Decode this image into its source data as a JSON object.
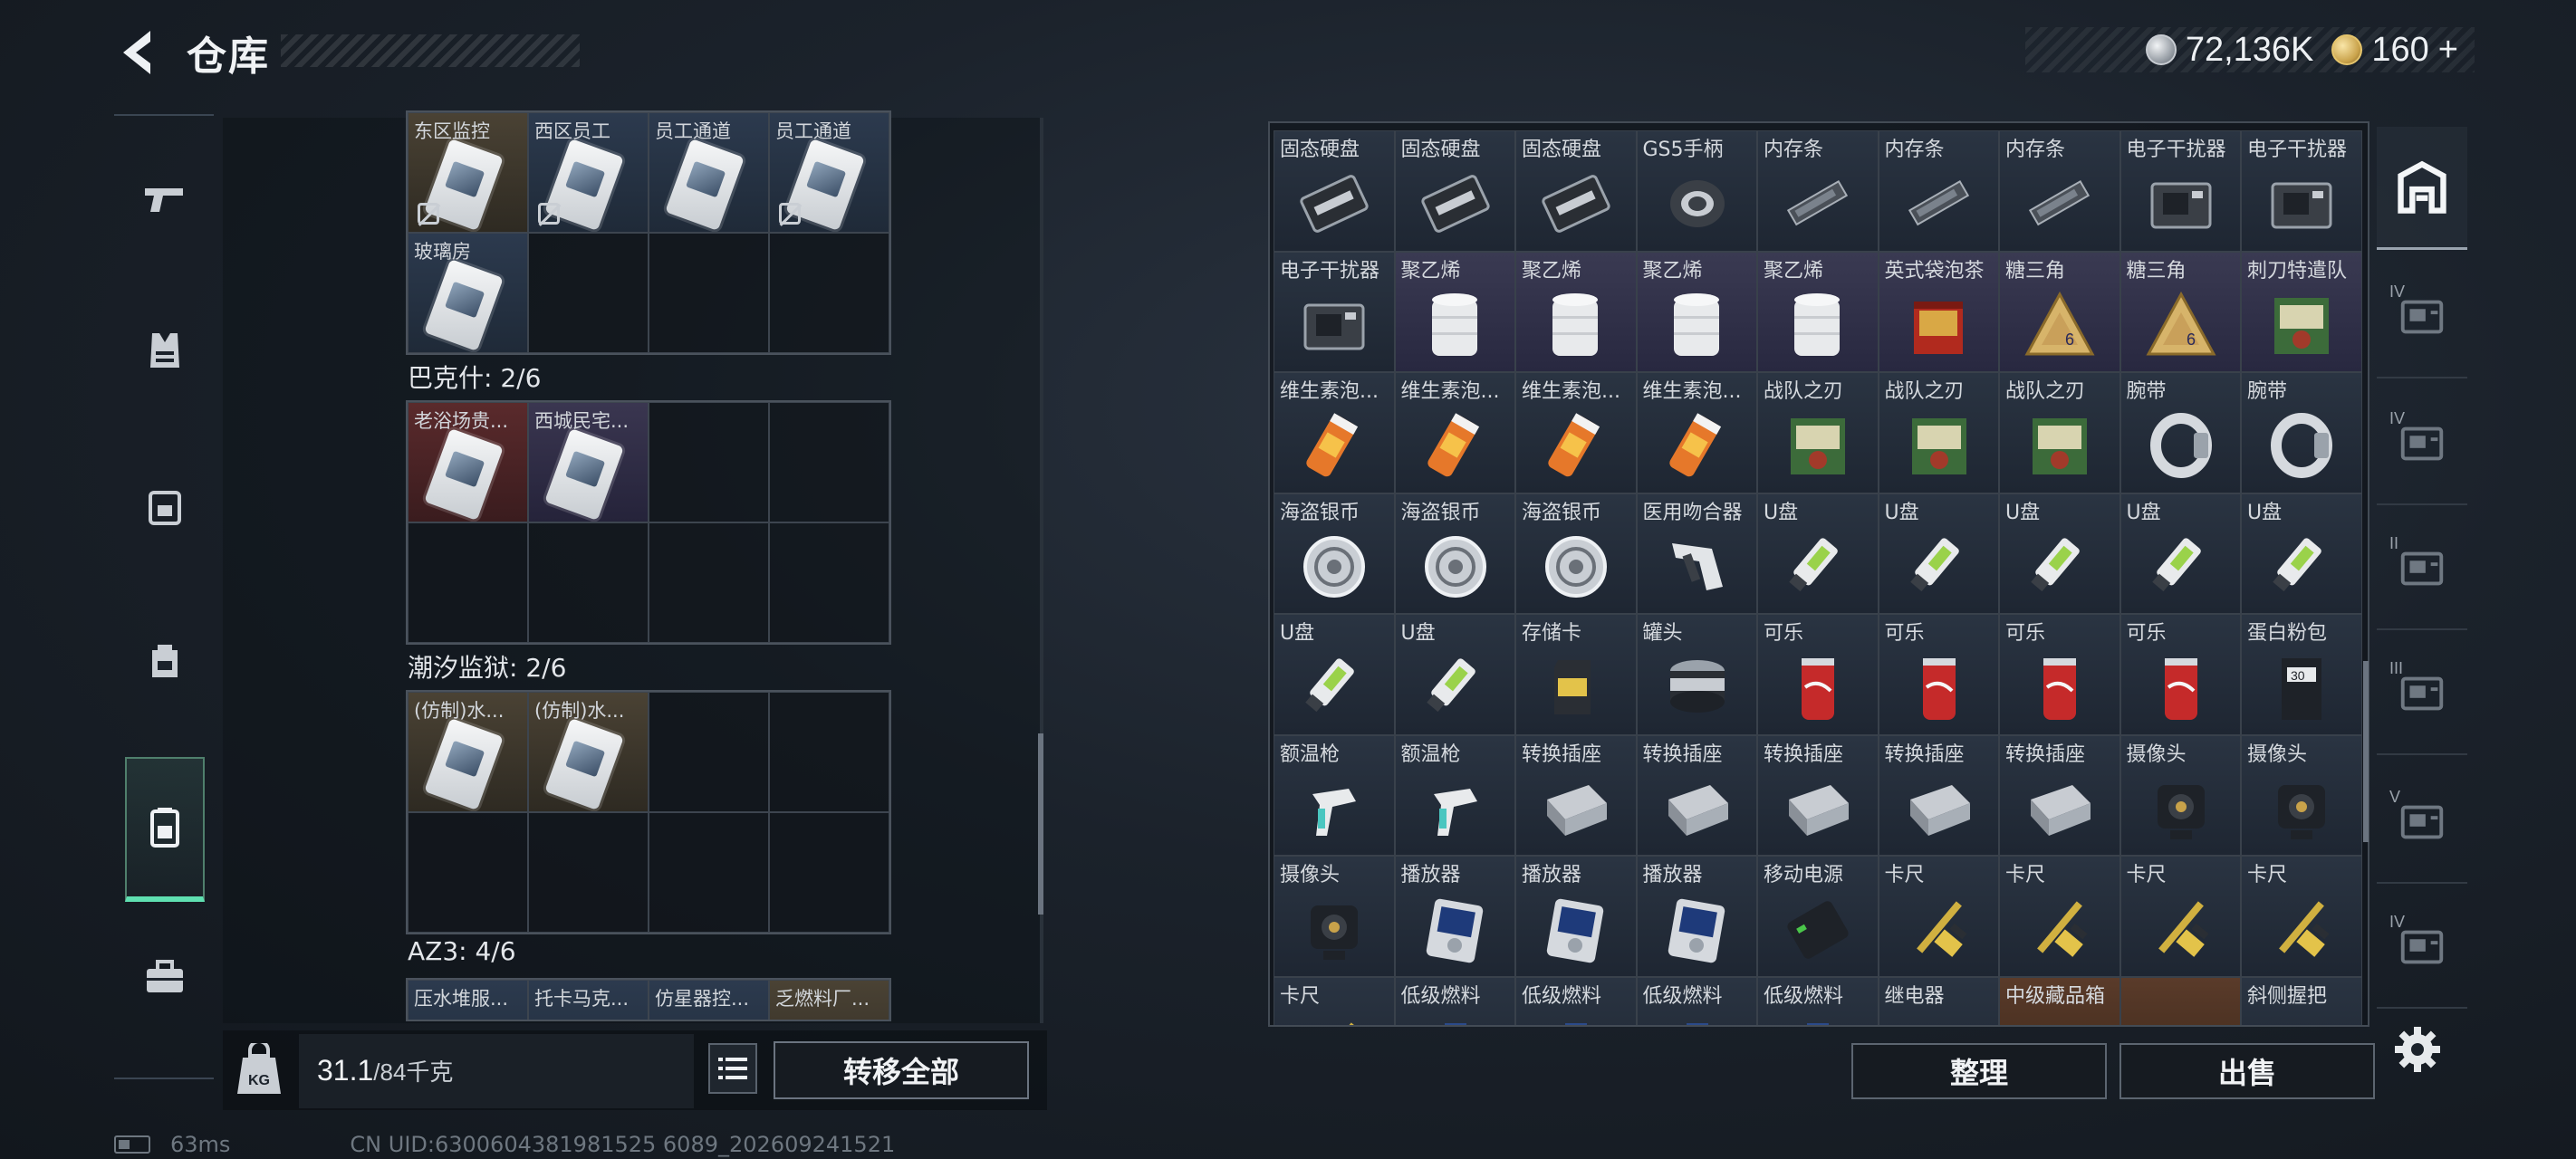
{
  "header": {
    "title": "仓库",
    "back_icon": "back-arrow-icon"
  },
  "currency": {
    "silver": "72,136K",
    "gold": "160",
    "add_label": "+"
  },
  "left_rail": [
    "pistol-icon",
    "armor-vest-icon",
    "chest-rig-icon",
    "backpack-icon",
    "container-case-icon",
    "toolbox-icon"
  ],
  "containers": [
    {
      "name": "",
      "cells": [
        {
          "label": "东区监控",
          "bg": "gold",
          "item": "keycard",
          "warn": true
        },
        {
          "label": "西区员工",
          "bg": "blue",
          "item": "keycard",
          "warn": true
        },
        {
          "label": "员工通道",
          "bg": "blue",
          "item": "keycard",
          "warn": false
        },
        {
          "label": "员工通道",
          "bg": "blue",
          "item": "keycard",
          "warn": true
        },
        {
          "label": "玻璃房",
          "bg": "blue",
          "item": "keycard",
          "warn": false
        },
        {
          "label": "",
          "bg": "",
          "item": "",
          "warn": false
        },
        {
          "label": "",
          "bg": "empty",
          "item": "",
          "warn": false
        },
        {
          "label": "",
          "bg": "empty",
          "item": "",
          "warn": false
        }
      ]
    },
    {
      "name": "巴克什: 2/6",
      "cells": [
        {
          "label": "老浴场贵...",
          "bg": "red",
          "item": "keycard",
          "warn": false
        },
        {
          "label": "西城民宅...",
          "bg": "purple",
          "item": "keycard",
          "warn": false
        },
        {
          "label": "",
          "bg": "",
          "item": "",
          "warn": false
        },
        {
          "label": "",
          "bg": "",
          "item": "",
          "warn": false
        },
        {
          "label": "",
          "bg": "",
          "item": "",
          "warn": false
        },
        {
          "label": "",
          "bg": "",
          "item": "",
          "warn": false
        },
        {
          "label": "",
          "bg": "empty",
          "item": "",
          "warn": false
        },
        {
          "label": "",
          "bg": "empty",
          "item": "",
          "warn": false
        }
      ]
    },
    {
      "name": "潮汐监狱: 2/6",
      "cells": [
        {
          "label": "(仿制)水...",
          "bg": "gold",
          "item": "keycard",
          "warn": false
        },
        {
          "label": "(仿制)水...",
          "bg": "gold",
          "item": "keycard",
          "warn": false
        },
        {
          "label": "",
          "bg": "",
          "item": "",
          "warn": false
        },
        {
          "label": "",
          "bg": "",
          "item": "",
          "warn": false
        },
        {
          "label": "",
          "bg": "",
          "item": "",
          "warn": false
        },
        {
          "label": "",
          "bg": "",
          "item": "",
          "warn": false
        },
        {
          "label": "",
          "bg": "empty",
          "item": "",
          "warn": false
        },
        {
          "label": "",
          "bg": "empty",
          "item": "",
          "warn": false
        }
      ]
    },
    {
      "name": "AZ3: 4/6",
      "cells": [
        {
          "label": "压水堆服...",
          "bg": "blue",
          "item": "",
          "warn": false
        },
        {
          "label": "托卡马克...",
          "bg": "blue",
          "item": "",
          "warn": false
        },
        {
          "label": "仿星器控...",
          "bg": "blue",
          "item": "",
          "warn": false
        },
        {
          "label": "乏燃料厂...",
          "bg": "gold",
          "item": "",
          "warn": false
        }
      ]
    }
  ],
  "weight": {
    "current": "31.1",
    "max": "/84千克",
    "icon": "kg-weight-icon"
  },
  "buttons": {
    "transfer_all": "转移全部",
    "sort": "整理",
    "sell": "出售",
    "list_icon": "list-icon",
    "settings_icon": "gear-icon"
  },
  "status": {
    "ping": "63ms",
    "uid": "CN UID:6300604381981525 6089_202609241521"
  },
  "stash": [
    {
      "label": "固态硬盘",
      "art": "ssd",
      "bg": ""
    },
    {
      "label": "固态硬盘",
      "art": "ssd",
      "bg": ""
    },
    {
      "label": "固态硬盘",
      "art": "ssd",
      "bg": ""
    },
    {
      "label": "GS5手柄",
      "art": "controller",
      "bg": ""
    },
    {
      "label": "内存条",
      "art": "ram",
      "bg": ""
    },
    {
      "label": "内存条",
      "art": "ram",
      "bg": ""
    },
    {
      "label": "内存条",
      "art": "ram",
      "bg": ""
    },
    {
      "label": "电子干扰器",
      "art": "jammer",
      "bg": ""
    },
    {
      "label": "电子干扰器",
      "art": "jammer",
      "bg": ""
    },
    {
      "label": "电子干扰器",
      "art": "jammer",
      "bg": ""
    },
    {
      "label": "聚乙烯",
      "art": "roll",
      "bg": "rare"
    },
    {
      "label": "聚乙烯",
      "art": "roll",
      "bg": "rare"
    },
    {
      "label": "聚乙烯",
      "art": "roll",
      "bg": "rare"
    },
    {
      "label": "聚乙烯",
      "art": "roll",
      "bg": "rare"
    },
    {
      "label": "英式袋泡茶",
      "art": "tea",
      "bg": "rare"
    },
    {
      "label": "糖三角",
      "art": "triangle",
      "bg": "rare"
    },
    {
      "label": "糖三角",
      "art": "triangle",
      "bg": "rare"
    },
    {
      "label": "刺刀特遣队",
      "art": "poster",
      "bg": "rare"
    },
    {
      "label": "维生素泡...",
      "art": "vitamin",
      "bg": ""
    },
    {
      "label": "维生素泡...",
      "art": "vitamin",
      "bg": ""
    },
    {
      "label": "维生素泡...",
      "art": "vitamin",
      "bg": ""
    },
    {
      "label": "维生素泡...",
      "art": "vitamin",
      "bg": ""
    },
    {
      "label": "战队之刃",
      "art": "poster",
      "bg": ""
    },
    {
      "label": "战队之刃",
      "art": "poster",
      "bg": ""
    },
    {
      "label": "战队之刃",
      "art": "poster",
      "bg": ""
    },
    {
      "label": "腕带",
      "art": "band",
      "bg": ""
    },
    {
      "label": "腕带",
      "art": "band",
      "bg": ""
    },
    {
      "label": "海盗银币",
      "art": "coin",
      "bg": ""
    },
    {
      "label": "海盗银币",
      "art": "coin",
      "bg": ""
    },
    {
      "label": "海盗银币",
      "art": "coin",
      "bg": ""
    },
    {
      "label": "医用吻合器",
      "art": "stapler",
      "bg": ""
    },
    {
      "label": "U盘",
      "art": "usb",
      "bg": ""
    },
    {
      "label": "U盘",
      "art": "usb",
      "bg": ""
    },
    {
      "label": "U盘",
      "art": "usb",
      "bg": ""
    },
    {
      "label": "U盘",
      "art": "usb",
      "bg": ""
    },
    {
      "label": "U盘",
      "art": "usb",
      "bg": ""
    },
    {
      "label": "U盘",
      "art": "usb",
      "bg": ""
    },
    {
      "label": "U盘",
      "art": "usb",
      "bg": ""
    },
    {
      "label": "存储卡",
      "art": "sdcard",
      "bg": ""
    },
    {
      "label": "罐头",
      "art": "can",
      "bg": ""
    },
    {
      "label": "可乐",
      "art": "cola",
      "bg": ""
    },
    {
      "label": "可乐",
      "art": "cola",
      "bg": ""
    },
    {
      "label": "可乐",
      "art": "cola",
      "bg": ""
    },
    {
      "label": "可乐",
      "art": "cola",
      "bg": ""
    },
    {
      "label": "蛋白粉包",
      "art": "pouch",
      "bg": ""
    },
    {
      "label": "额温枪",
      "art": "thermo",
      "bg": ""
    },
    {
      "label": "额温枪",
      "art": "thermo",
      "bg": ""
    },
    {
      "label": "转换插座",
      "art": "socket",
      "bg": ""
    },
    {
      "label": "转换插座",
      "art": "socket",
      "bg": ""
    },
    {
      "label": "转换插座",
      "art": "socket",
      "bg": ""
    },
    {
      "label": "转换插座",
      "art": "socket",
      "bg": ""
    },
    {
      "label": "转换插座",
      "art": "socket",
      "bg": ""
    },
    {
      "label": "摄像头",
      "art": "camera",
      "bg": ""
    },
    {
      "label": "摄像头",
      "art": "camera",
      "bg": ""
    },
    {
      "label": "摄像头",
      "art": "camera",
      "bg": ""
    },
    {
      "label": "播放器",
      "art": "player",
      "bg": ""
    },
    {
      "label": "播放器",
      "art": "player",
      "bg": ""
    },
    {
      "label": "播放器",
      "art": "player",
      "bg": ""
    },
    {
      "label": "移动电源",
      "art": "powerbank",
      "bg": ""
    },
    {
      "label": "卡尺",
      "art": "caliper",
      "bg": ""
    },
    {
      "label": "卡尺",
      "art": "caliper",
      "bg": ""
    },
    {
      "label": "卡尺",
      "art": "caliper",
      "bg": ""
    },
    {
      "label": "卡尺",
      "art": "caliper",
      "bg": ""
    },
    {
      "label": "卡尺",
      "art": "caliper",
      "bg": ""
    },
    {
      "label": "低级燃料",
      "art": "fuel",
      "bg": ""
    },
    {
      "label": "低级燃料",
      "art": "fuel",
      "bg": ""
    },
    {
      "label": "低级燃料",
      "art": "fuel",
      "bg": ""
    },
    {
      "label": "低级燃料",
      "art": "fuel",
      "bg": ""
    },
    {
      "label": "继电器",
      "art": "relay",
      "bg": ""
    },
    {
      "label": "中级藏品箱",
      "art": "crate",
      "bg": "gold"
    },
    {
      "label": "",
      "art": "",
      "bg": "gold"
    },
    {
      "label": "斜侧握把",
      "art": "grip",
      "bg": ""
    }
  ],
  "right_tabs": [
    {
      "icon": "stash-home-icon",
      "tier": ""
    },
    {
      "icon": "folder-case-icon",
      "tier": "IV"
    },
    {
      "icon": "medkit-case-icon",
      "tier": "IV"
    },
    {
      "icon": "photo-case-icon",
      "tier": "II"
    },
    {
      "icon": "weapon-case-icon",
      "tier": "III"
    },
    {
      "icon": "ammo-case-icon",
      "tier": "V"
    },
    {
      "icon": "tool-case-icon",
      "tier": "IV"
    }
  ]
}
